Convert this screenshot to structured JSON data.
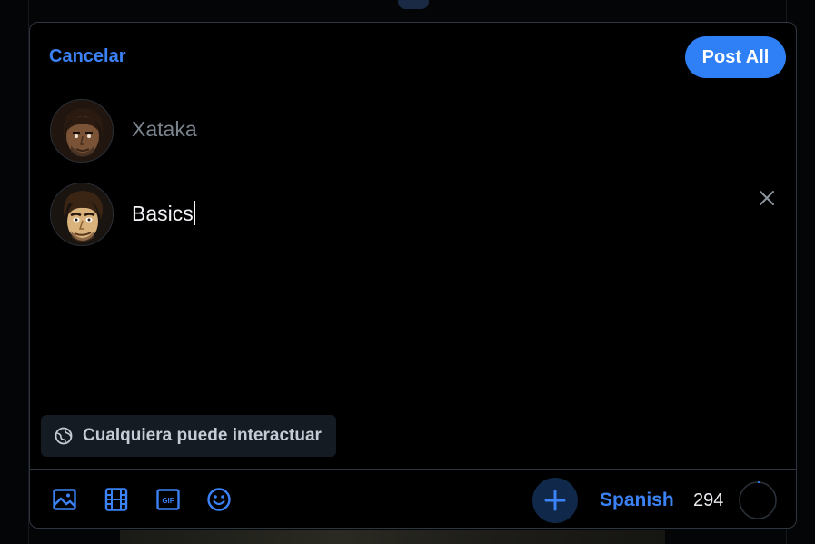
{
  "composer": {
    "cancel_label": "Cancelar",
    "post_all_label": "Post All",
    "posts": [
      {
        "text": "",
        "placeholder": "Xataka",
        "active": false
      },
      {
        "text": "Basics",
        "active": true
      }
    ],
    "interaction_setting": "Cualquiera puede interactuar",
    "toolbar": {
      "tools": [
        "image-icon",
        "video-icon",
        "gif-icon",
        "emoji-icon"
      ],
      "gif_text": "GIF",
      "language": "Spanish",
      "chars_remaining": "294",
      "char_progress": 0.02
    },
    "colors": {
      "accent": "#3b82f6",
      "post_button": "#2f80f6",
      "background": "#000000",
      "border": "#2e3640"
    }
  }
}
